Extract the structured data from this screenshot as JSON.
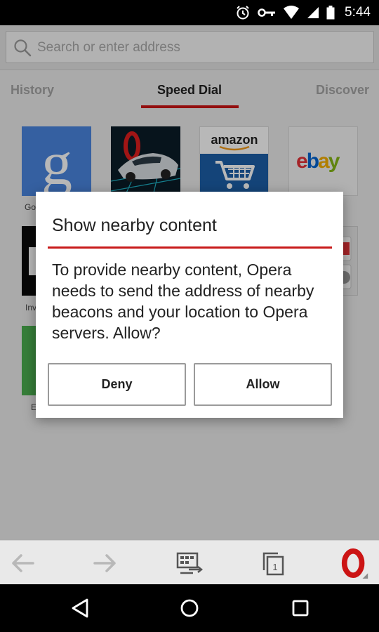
{
  "status_bar": {
    "time": "5:44",
    "icons": [
      "alarm-icon",
      "vpn-key-icon",
      "wifi-icon",
      "signal-icon",
      "battery-icon"
    ]
  },
  "address_bar": {
    "placeholder": "Search or enter address",
    "value": ""
  },
  "tabs": [
    {
      "label": "History",
      "active": false
    },
    {
      "label": "Speed Dial",
      "active": true
    },
    {
      "label": "Discover",
      "active": false
    }
  ],
  "speed_dial": {
    "tiles": [
      {
        "name": "Google",
        "label": "Go",
        "icon": "google-g-icon"
      },
      {
        "name": "Opera",
        "label": "",
        "icon": "opera-car-icon"
      },
      {
        "name": "Amazon",
        "label": "",
        "icon": "amazon-icon",
        "text": "amazon"
      },
      {
        "name": "eBay",
        "label": "",
        "icon": "ebay-icon",
        "text": "ebay"
      },
      {
        "name": "Investing",
        "label": "Inv",
        "icon": "black-tile-icon"
      },
      {
        "name": "Folder",
        "label": "",
        "icon": "folder-icon"
      },
      {
        "name": "Green",
        "label": "E",
        "icon": "green-tile-icon"
      }
    ]
  },
  "dialog": {
    "title": "Show nearby content",
    "message": "To provide nearby content, Opera needs to send the address of nearby beacons and your location to Opera servers. Allow?",
    "deny_label": "Deny",
    "allow_label": "Allow"
  },
  "toolbar": {
    "tabs_count": "1",
    "items": [
      "back-arrow-icon",
      "forward-arrow-icon",
      "speed-dial-switch-icon",
      "tabs-icon",
      "opera-menu-icon"
    ]
  },
  "colors": {
    "accent": "#cc1414",
    "google_blue": "#4285f4",
    "ebay_red": "#e53238",
    "ebay_blue": "#0064d2",
    "ebay_yellow": "#f5af02",
    "ebay_green": "#86b817"
  }
}
